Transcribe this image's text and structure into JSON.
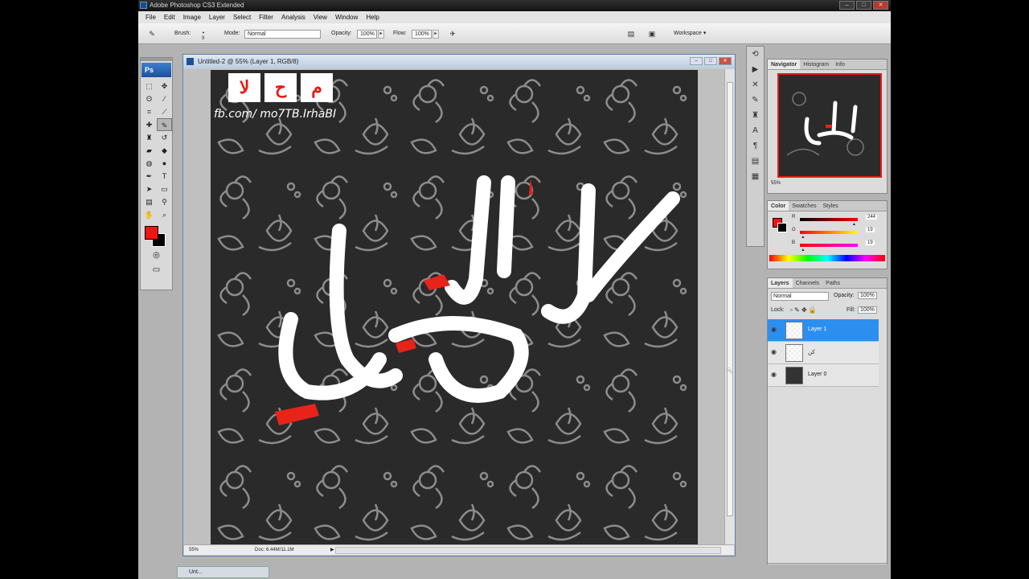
{
  "titlebar": {
    "text": "Adobe Photoshop CS3 Extended"
  },
  "menu": [
    "File",
    "Edit",
    "Image",
    "Layer",
    "Select",
    "Filter",
    "Analysis",
    "View",
    "Window",
    "Help"
  ],
  "options": {
    "brush_label": "Brush:",
    "brush_size": "9",
    "mode_label": "Mode:",
    "mode_value": "Normal",
    "opacity_label": "Opacity:",
    "opacity_value": "100%",
    "flow_label": "Flow:",
    "flow_value": "100%",
    "workspace_label": "Workspace ▾"
  },
  "toolbox": {
    "logo": "Ps",
    "fg_color": "#f41313",
    "bg_color": "#000000"
  },
  "document": {
    "title": "Untitled-2 @ 55% (Layer 1, RGB/8)",
    "zoom": "55%",
    "doc_info": "Doc: 6.44M/11.1M",
    "badges": [
      "ﻻ",
      "ح",
      "م"
    ],
    "credit": "fb.com/ mo7TB.IrhaBI"
  },
  "navigator": {
    "tabs": [
      "Navigator",
      "Histogram",
      "Info"
    ],
    "zoom": "55%"
  },
  "color_panel": {
    "tabs": [
      "Color",
      "Swatches",
      "Styles"
    ],
    "r_label": "R",
    "r_value": "244",
    "r_fraction": 0.957,
    "g_label": "G",
    "g_value": "19",
    "g_fraction": 0.075,
    "b_label": "B",
    "b_value": "19",
    "b_fraction": 0.075
  },
  "layers_panel": {
    "tabs": [
      "Layers",
      "Channels",
      "Paths"
    ],
    "blend_mode": "Normal",
    "opacity_label": "Opacity:",
    "opacity_value": "100%",
    "lock_label": "Lock:",
    "fill_label": "Fill:",
    "fill_value": "100%",
    "layers": [
      {
        "name": "Layer 1",
        "selected": true
      },
      {
        "name": "كن",
        "selected": false
      },
      {
        "name": "Layer 0",
        "selected": false
      }
    ]
  },
  "taskbar": {
    "item": "Unt..."
  }
}
